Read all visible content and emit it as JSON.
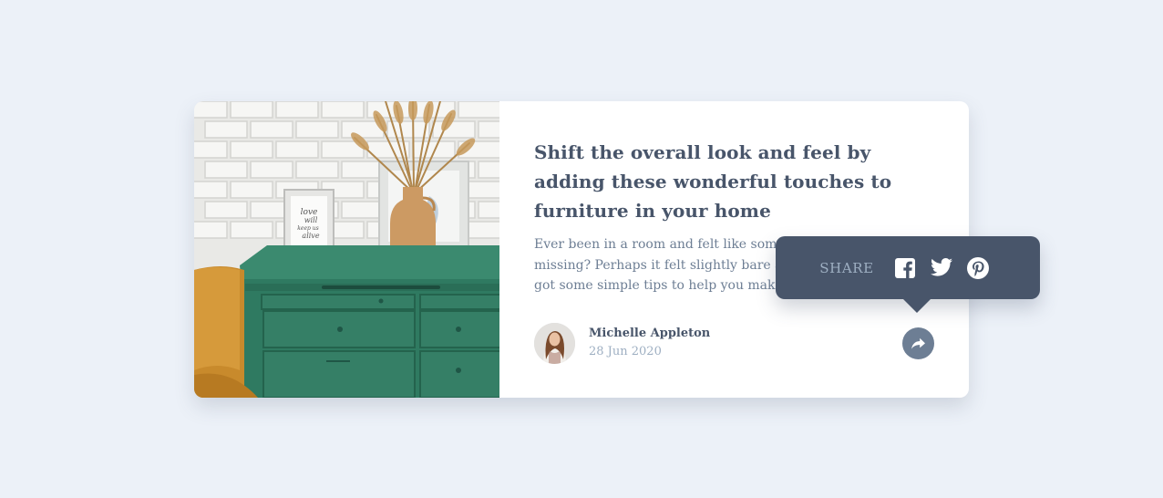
{
  "article": {
    "title": "Shift the overall look and feel by adding these wonderful touches to furniture in your home",
    "excerpt": "Ever been in a room and felt like something was missing? Perhaps it felt slightly bare and uninviting. I've got some simple tips to help you make any room feel complete.",
    "image_alt": "green drawers with vase and picture frames"
  },
  "author": {
    "name": "Michelle Appleton",
    "date": "28 Jun 2020"
  },
  "share": {
    "label": "SHARE",
    "networks": [
      "facebook-icon",
      "twitter-icon",
      "pinterest-icon"
    ]
  },
  "photo_frame_text": "love will keep us alive",
  "colors": {
    "background": "#ecf1f8",
    "title": "#48556a",
    "muted": "#9eafc2",
    "share_popup": "#48556a",
    "share_button": "#6d7e94"
  }
}
